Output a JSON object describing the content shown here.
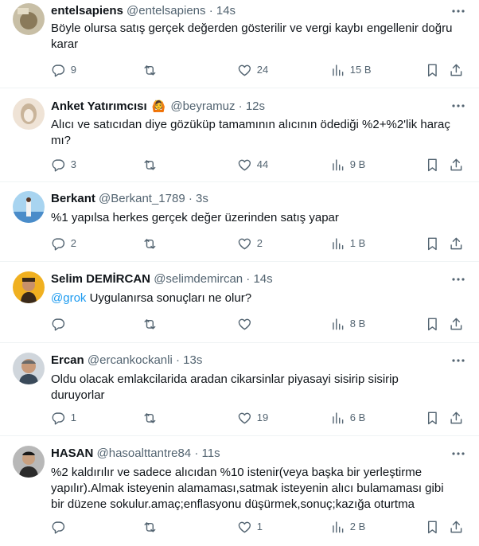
{
  "tweets": [
    {
      "name": "entelsapiens",
      "emoji": "",
      "handle": "@entelsapiens",
      "dot": "·",
      "time": "14s",
      "mention": "",
      "lines": [
        "Böyle olursa satış gerçek değerden gösterilir ve vergi kaybı engellenir doğru",
        "karar"
      ],
      "replies": "9",
      "retweets": "",
      "likes": "24",
      "views": "15 B",
      "avatar_colors": [
        "#9a8a6a",
        "#d8d0b8"
      ]
    },
    {
      "name": "Anket Yatırımcısı",
      "emoji": "🙆",
      "handle": "@beyramuz",
      "dot": "·",
      "time": "12s",
      "mention": "",
      "lines": [
        "Alıcı ve satıcıdan diye gözüküp tamamının alıcının ödediği %2+%2'lik haraç",
        "mı?"
      ],
      "replies": "3",
      "retweets": "",
      "likes": "44",
      "views": "9 B",
      "avatar_colors": [
        "#c9b49a",
        "#efe3d6"
      ]
    },
    {
      "name": "Berkant",
      "emoji": "",
      "handle": "@Berkant_1789",
      "dot": "·",
      "time": "3s",
      "mention": "",
      "lines": [
        "%1 yapılsa herkes gerçek değer üzerinden satış yapar"
      ],
      "replies": "2",
      "retweets": "",
      "likes": "2",
      "views": "1 B",
      "avatar_colors": [
        "#4a8cc9",
        "#a8d4f0"
      ]
    },
    {
      "name": "Selim DEMİRCAN",
      "emoji": "",
      "handle": "@selimdemircan",
      "dot": "·",
      "time": "14s",
      "mention": "@grok",
      "lines": [
        "Uygulanırsa sonuçları ne olur?"
      ],
      "replies": "",
      "retweets": "",
      "likes": "",
      "views": "8 B",
      "avatar_colors": [
        "#f0b020",
        "#3a2a1a"
      ]
    },
    {
      "name": "Ercan",
      "emoji": "",
      "handle": "@ercankockanli",
      "dot": "·",
      "time": "13s",
      "mention": "",
      "lines": [
        "Oldu olacak emlakcilarida aradan cikarsinlar piyasayi sisirip sisirip",
        "duruyorlar"
      ],
      "replies": "1",
      "retweets": "",
      "likes": "19",
      "views": "6 B",
      "avatar_colors": [
        "#6a7a8a",
        "#d0d6dc"
      ]
    },
    {
      "name": "HASAN",
      "emoji": "",
      "handle": "@hasoalttantre84",
      "dot": "·",
      "time": "11s",
      "mention": "",
      "lines": [
        "%2 kaldırılır ve sadece alıcıdan %10 istenir(veya başka bir yerleştirme",
        "yapılır).Almak isteyenin alamaması,satmak isteyenin alıcı bulamaması gibi",
        "bir düzene sokulur.amaç;enflasyonu düşürmek,sonuç;kazığa oturtma"
      ],
      "replies": "",
      "retweets": "",
      "likes": "1",
      "views": "2 B",
      "avatar_colors": [
        "#3a3a3a",
        "#b8b8b8"
      ]
    }
  ]
}
